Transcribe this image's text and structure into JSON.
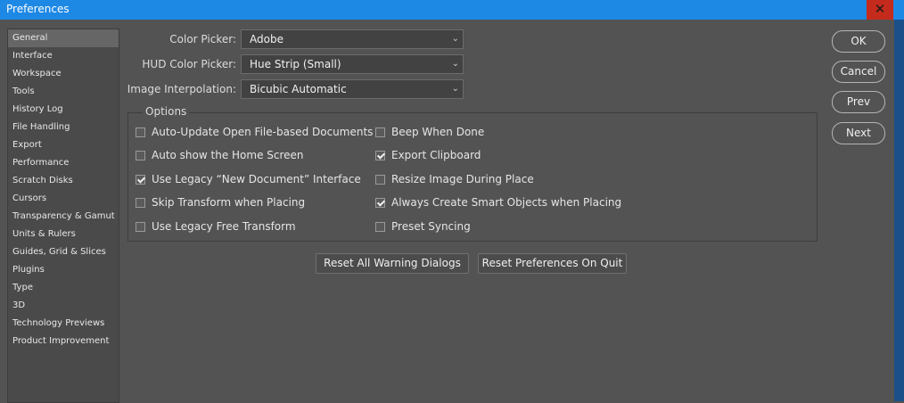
{
  "window": {
    "title": "Preferences",
    "close_glyph": "✕"
  },
  "sidebar": {
    "items": [
      {
        "label": "General",
        "selected": true
      },
      {
        "label": "Interface"
      },
      {
        "label": "Workspace"
      },
      {
        "label": "Tools"
      },
      {
        "label": "History Log"
      },
      {
        "label": "File Handling"
      },
      {
        "label": "Export"
      },
      {
        "label": "Performance"
      },
      {
        "label": "Scratch Disks"
      },
      {
        "label": "Cursors"
      },
      {
        "label": "Transparency & Gamut"
      },
      {
        "label": "Units & Rulers"
      },
      {
        "label": "Guides, Grid & Slices"
      },
      {
        "label": "Plugins"
      },
      {
        "label": "Type"
      },
      {
        "label": "3D"
      },
      {
        "label": "Technology Previews"
      },
      {
        "label": "Product Improvement"
      }
    ]
  },
  "fields": {
    "color_picker": {
      "label": "Color Picker:",
      "value": "Adobe"
    },
    "hud_color_picker": {
      "label": "HUD Color Picker:",
      "value": "Hue Strip (Small)"
    },
    "image_interpolation": {
      "label": "Image Interpolation:",
      "value": "Bicubic Automatic"
    }
  },
  "options": {
    "legend": "Options",
    "left": [
      {
        "label": "Auto-Update Open File-based Documents",
        "checked": false
      },
      {
        "label": "Auto show the Home Screen",
        "checked": false
      },
      {
        "label": "Use Legacy “New Document” Interface",
        "checked": true
      },
      {
        "label": "Skip Transform when Placing",
        "checked": false
      },
      {
        "label": "Use Legacy Free Transform",
        "checked": false
      }
    ],
    "right": [
      {
        "label": "Beep When Done",
        "checked": false
      },
      {
        "label": "Export Clipboard",
        "checked": true
      },
      {
        "label": "Resize Image During Place",
        "checked": false
      },
      {
        "label": "Always Create Smart Objects when Placing",
        "checked": true
      },
      {
        "label": "Preset Syncing",
        "checked": false
      }
    ]
  },
  "buttons": {
    "reset_warnings": "Reset All Warning Dialogs",
    "reset_prefs": "Reset Preferences On Quit",
    "ok": "OK",
    "cancel": "Cancel",
    "prev": "Prev",
    "next": "Next"
  },
  "icons": {
    "chevron": "⌄"
  },
  "colors": {
    "titlebar": "#1e88e5",
    "close": "#c42b1c",
    "panel_bg": "#535353"
  }
}
